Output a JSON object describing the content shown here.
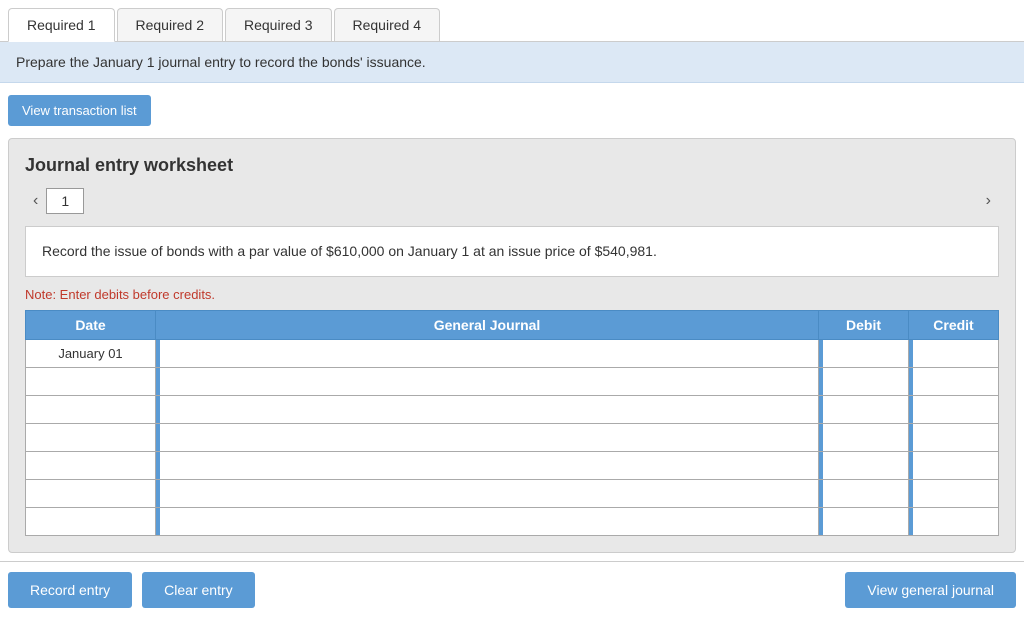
{
  "tabs": [
    {
      "label": "Required 1",
      "active": true
    },
    {
      "label": "Required 2",
      "active": false
    },
    {
      "label": "Required 3",
      "active": false
    },
    {
      "label": "Required 4",
      "active": false
    }
  ],
  "info_banner": {
    "text": "Prepare the January 1 journal entry to record the bonds' issuance."
  },
  "view_transaction_btn": "View transaction list",
  "worksheet": {
    "title": "Journal entry worksheet",
    "page_num": "1",
    "description": "Record the issue of bonds with a par value of $610,000 on January 1 at an issue price of $540,981.",
    "note": "Note: Enter debits before credits.",
    "table": {
      "headers": {
        "date": "Date",
        "general_journal": "General Journal",
        "debit": "Debit",
        "credit": "Credit"
      },
      "rows": [
        {
          "date": "January 01",
          "general_journal": "",
          "debit": "",
          "credit": ""
        },
        {
          "date": "",
          "general_journal": "",
          "debit": "",
          "credit": ""
        },
        {
          "date": "",
          "general_journal": "",
          "debit": "",
          "credit": ""
        },
        {
          "date": "",
          "general_journal": "",
          "debit": "",
          "credit": ""
        },
        {
          "date": "",
          "general_journal": "",
          "debit": "",
          "credit": ""
        },
        {
          "date": "",
          "general_journal": "",
          "debit": "",
          "credit": ""
        },
        {
          "date": "",
          "general_journal": "",
          "debit": "",
          "credit": ""
        }
      ]
    }
  },
  "buttons": {
    "record_entry": "Record entry",
    "clear_entry": "Clear entry",
    "view_general_journal": "View general journal"
  }
}
